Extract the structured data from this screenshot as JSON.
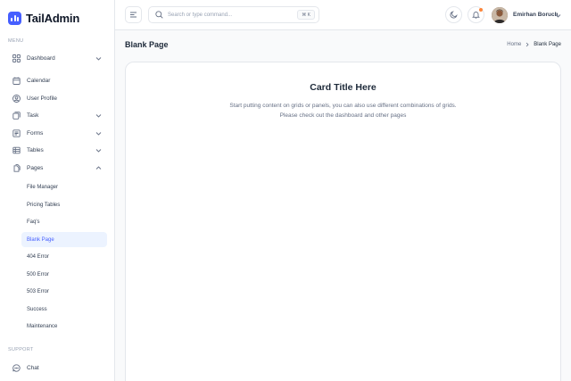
{
  "brand": {
    "name": "TailAdmin",
    "accent": "#465fff"
  },
  "sidebar": {
    "menu_label": "MENU",
    "support_label": "SUPPORT",
    "items": [
      {
        "label": "Dashboard",
        "icon": "grid-icon"
      },
      {
        "label": "Calendar",
        "icon": "calendar-icon"
      },
      {
        "label": "User Profile",
        "icon": "user-circle-icon"
      },
      {
        "label": "Task",
        "icon": "task-icon"
      },
      {
        "label": "Forms",
        "icon": "forms-icon"
      },
      {
        "label": "Tables",
        "icon": "table-icon"
      },
      {
        "label": "Pages",
        "icon": "pages-icon"
      }
    ],
    "pages_sub": [
      "File Manager",
      "Pricing Tables",
      "Faq's",
      "Blank Page",
      "404 Error",
      "500 Error",
      "503 Error",
      "Success",
      "Maintenance"
    ],
    "active_sub": "Blank Page",
    "support_items": [
      {
        "label": "Chat",
        "icon": "chat-icon"
      }
    ]
  },
  "header": {
    "search_placeholder": "Search or type command...",
    "search_shortcut": "⌘ K",
    "user_name": "Emirhan Boruch"
  },
  "main": {
    "page_title": "Blank Page",
    "breadcrumb": {
      "home": "Home",
      "current": "Blank Page"
    },
    "card": {
      "title": "Card Title Here",
      "line1": "Start putting content on grids or panels, you can also use different combinations of grids.",
      "line2": "Please check out the dashboard and other pages"
    }
  }
}
